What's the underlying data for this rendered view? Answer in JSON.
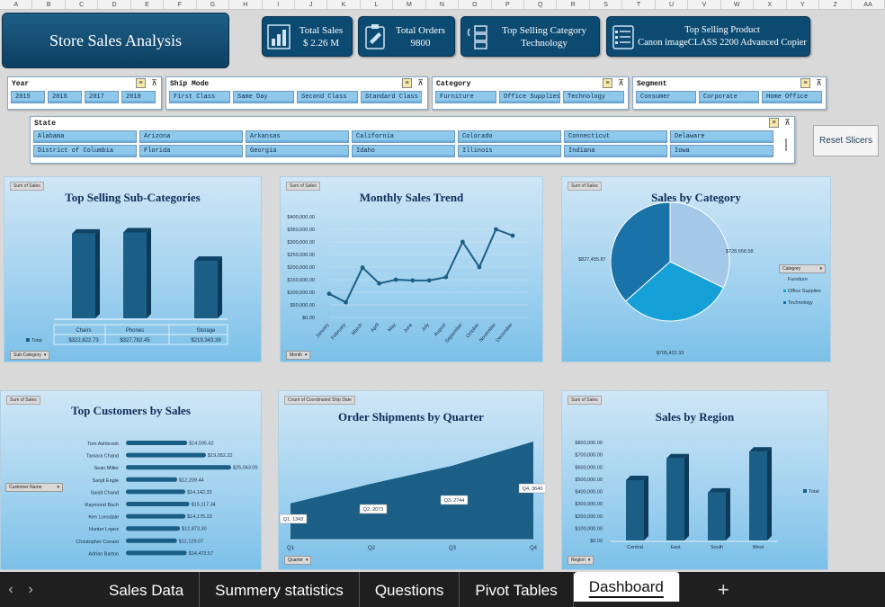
{
  "columns": [
    "A",
    "B",
    "C",
    "D",
    "E",
    "F",
    "G",
    "H",
    "I",
    "J",
    "K",
    "L",
    "M",
    "N",
    "O",
    "P",
    "Q",
    "R",
    "S",
    "T",
    "U",
    "V",
    "W",
    "X",
    "Y",
    "Z",
    "AA"
  ],
  "title": "Store Sales Analysis",
  "kpis": [
    {
      "label": "Total Sales",
      "value": "$ 2.26 M",
      "icon": "bar-chart-icon"
    },
    {
      "label": "Total Orders",
      "value": "9800",
      "icon": "clipboard-icon"
    },
    {
      "label": "Top Selling Category",
      "value": "Technology",
      "icon": "list-icon"
    },
    {
      "label": "Top Selling Product",
      "value": "Canon imageCLASS 2200 Advanced Copier",
      "icon": "checklist-icon"
    }
  ],
  "slicers": {
    "year": {
      "title": "Year",
      "items": [
        "2015",
        "2016",
        "2017",
        "2018"
      ]
    },
    "ship_mode": {
      "title": "Ship Mode",
      "items": [
        "First Class",
        "Same Day",
        "Second Class",
        "Standard Class"
      ]
    },
    "category": {
      "title": "Category",
      "items": [
        "Furniture",
        "Office Supplies",
        "Technology"
      ]
    },
    "segment": {
      "title": "Segment",
      "items": [
        "Consumer",
        "Corporate",
        "Home Office"
      ]
    },
    "state": {
      "title": "State",
      "items": [
        "Alabama",
        "Arizona",
        "Arkansas",
        "California",
        "Colorado",
        "Connecticut",
        "Delaware",
        "District of Columbia",
        "Florida",
        "Georgia",
        "Idaho",
        "Illinois",
        "Indiana",
        "Iowa"
      ]
    }
  },
  "reset_label": "Reset Slicers",
  "colors": {
    "bar": "#1b5f86",
    "accent": "#0c4a72",
    "pie": [
      "#1a73a8",
      "#a3c8e8",
      "#16a0d8"
    ]
  },
  "charts": {
    "sub": {
      "tag": "Sum of Sales",
      "title": "Top Selling Sub-Categories",
      "field": "Sub-Category",
      "legend": "Total"
    },
    "monthly": {
      "tag": "Sum of Sales",
      "title": "Monthly Sales Trend",
      "field": "Month"
    },
    "category": {
      "tag": "Sum of Sales",
      "title": "Sales by Category",
      "legend_title": "Category"
    },
    "customers": {
      "tag": "Sum of Sales",
      "title": "Top Customers by Sales",
      "field": "Customer Name"
    },
    "quarter": {
      "tag": "Count of Coordinated Ship Date",
      "title": "Order Shipments by Quarter",
      "field": "Quarter"
    },
    "region": {
      "tag": "Sum of Sales",
      "title": "Sales by Region",
      "field": "Region",
      "legend": "Total"
    }
  },
  "chart_data": [
    {
      "type": "bar",
      "title": "Top Selling Sub-Categories",
      "categories": [
        "Chairs",
        "Phones",
        "Storage"
      ],
      "values": [
        322822.73,
        327782.45,
        219343.39
      ],
      "value_labels": [
        "$322,822.73",
        "$327,782.45",
        "$219,343.39"
      ],
      "legend": "Total"
    },
    {
      "type": "line",
      "title": "Monthly Sales Trend",
      "categories": [
        "January",
        "February",
        "March",
        "April",
        "May",
        "June",
        "July",
        "August",
        "September",
        "October",
        "November",
        "December"
      ],
      "values": [
        94000,
        60000,
        198000,
        135000,
        150000,
        147000,
        147000,
        160000,
        300000,
        200000,
        350000,
        325000
      ],
      "ylim": [
        0,
        400000
      ],
      "yticks": [
        "$400,000.00",
        "$350,000.00",
        "$300,000.00",
        "$250,000.00",
        "$200,000.00",
        "$150,000.00",
        "$100,000.00",
        "$50,000.00",
        "$0.00"
      ]
    },
    {
      "type": "pie",
      "title": "Sales by Category",
      "categories": [
        "Furniture",
        "Office Supplies",
        "Technology"
      ],
      "values": [
        728658.58,
        705422.33,
        827455.87
      ],
      "value_labels": [
        "$728,658.58",
        "$705,422.33",
        "$827,455.87"
      ]
    },
    {
      "type": "bar",
      "title": "Top Customers by Sales",
      "categories": [
        "Tom Ashbrook",
        "Tamara Chand",
        "Sean Miller",
        "Sanjit Engle",
        "Sanjit Chand",
        "Raymond Buch",
        "Ken Lonsdale",
        "Hunter Lopez",
        "Christopher Conant",
        "Adrian Barton"
      ],
      "values": [
        14595.62,
        19052.22,
        25043.05,
        12209.44,
        14142.33,
        15117.34,
        14175.23,
        12873.3,
        12129.07,
        14473.57
      ],
      "value_labels": [
        "$14,595.62",
        "$19,052.22",
        "$25,043.05",
        "$12,209.44",
        "$14,142.33",
        "$15,117.34",
        "$14,175.23",
        "$12,873.30",
        "$12,129.07",
        "$14,473.57"
      ]
    },
    {
      "type": "area",
      "title": "Order Shipments by Quarter",
      "categories": [
        "Q1",
        "Q2",
        "Q3",
        "Q4"
      ],
      "values": [
        1343,
        2073,
        2744,
        3640
      ],
      "data_labels": [
        "Q1, 1343",
        "Q2, 2073",
        "Q3, 2744",
        "Q4, 3640"
      ]
    },
    {
      "type": "bar",
      "title": "Sales by Region",
      "categories": [
        "Central",
        "East",
        "South",
        "West"
      ],
      "values": [
        492000,
        670000,
        390000,
        725000
      ],
      "ylim": [
        0,
        800000
      ],
      "yticks": [
        "$800,000.00",
        "$700,000.00",
        "$600,000.00",
        "$500,000.00",
        "$400,000.00",
        "$300,000.00",
        "$200,000.00",
        "$100,000.00",
        "$0.00"
      ],
      "legend": "Total"
    }
  ],
  "tabs": [
    "Sales Data",
    "Summery statistics",
    "Questions",
    "Pivot Tables",
    "Dashboard"
  ],
  "active_tab": "Dashboard",
  "nav": {
    "prev": "‹",
    "next": "›",
    "add": "+"
  }
}
